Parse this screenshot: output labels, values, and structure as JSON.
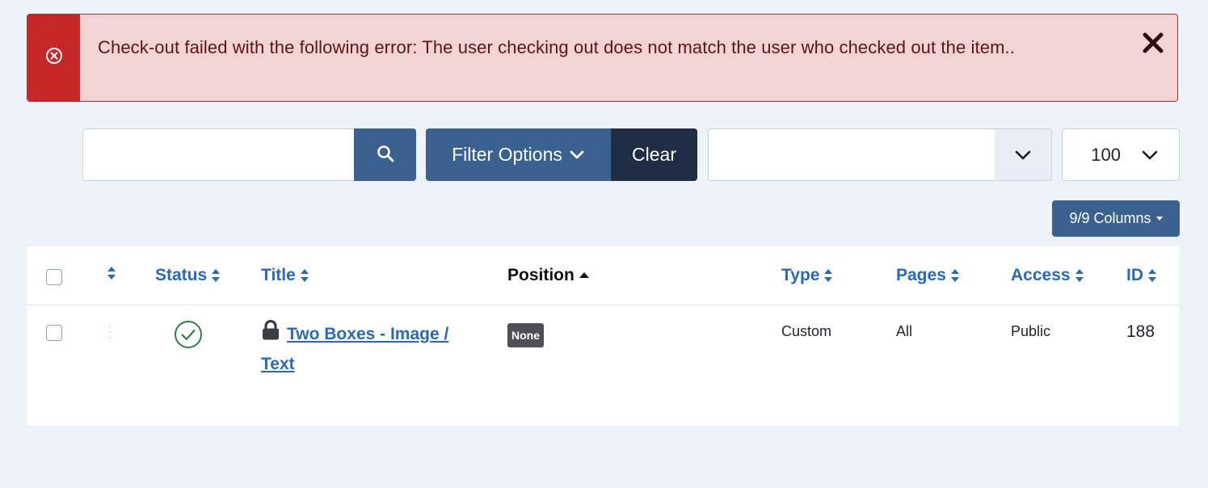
{
  "alert": {
    "message": "Check-out failed with the following error: The user checking out does not match the user who checked out the item..",
    "icon": "error-circle-icon",
    "close_icon": "close-icon",
    "color": "#c52827"
  },
  "toolbar": {
    "search": {
      "value": "",
      "placeholder": ""
    },
    "filter_options_label": "Filter Options",
    "clear_label": "Clear",
    "sort_select_value": "",
    "limit_select_value": "100",
    "columns_label": "9/9 Columns"
  },
  "table": {
    "columns": {
      "status": "Status",
      "title": "Title",
      "position": "Position",
      "type": "Type",
      "pages": "Pages",
      "access": "Access",
      "id": "ID"
    },
    "rows": [
      {
        "title": "Two Boxes - Image / Text",
        "locked": true,
        "published": true,
        "position": "None",
        "type": "Custom",
        "pages": "All",
        "access": "Public",
        "id": "188"
      }
    ]
  },
  "colors": {
    "primary": "#3b6191",
    "dark": "#1f2e45",
    "link": "#2a69b8",
    "success": "#2f7d44",
    "page_bg": "#eef3fa"
  }
}
